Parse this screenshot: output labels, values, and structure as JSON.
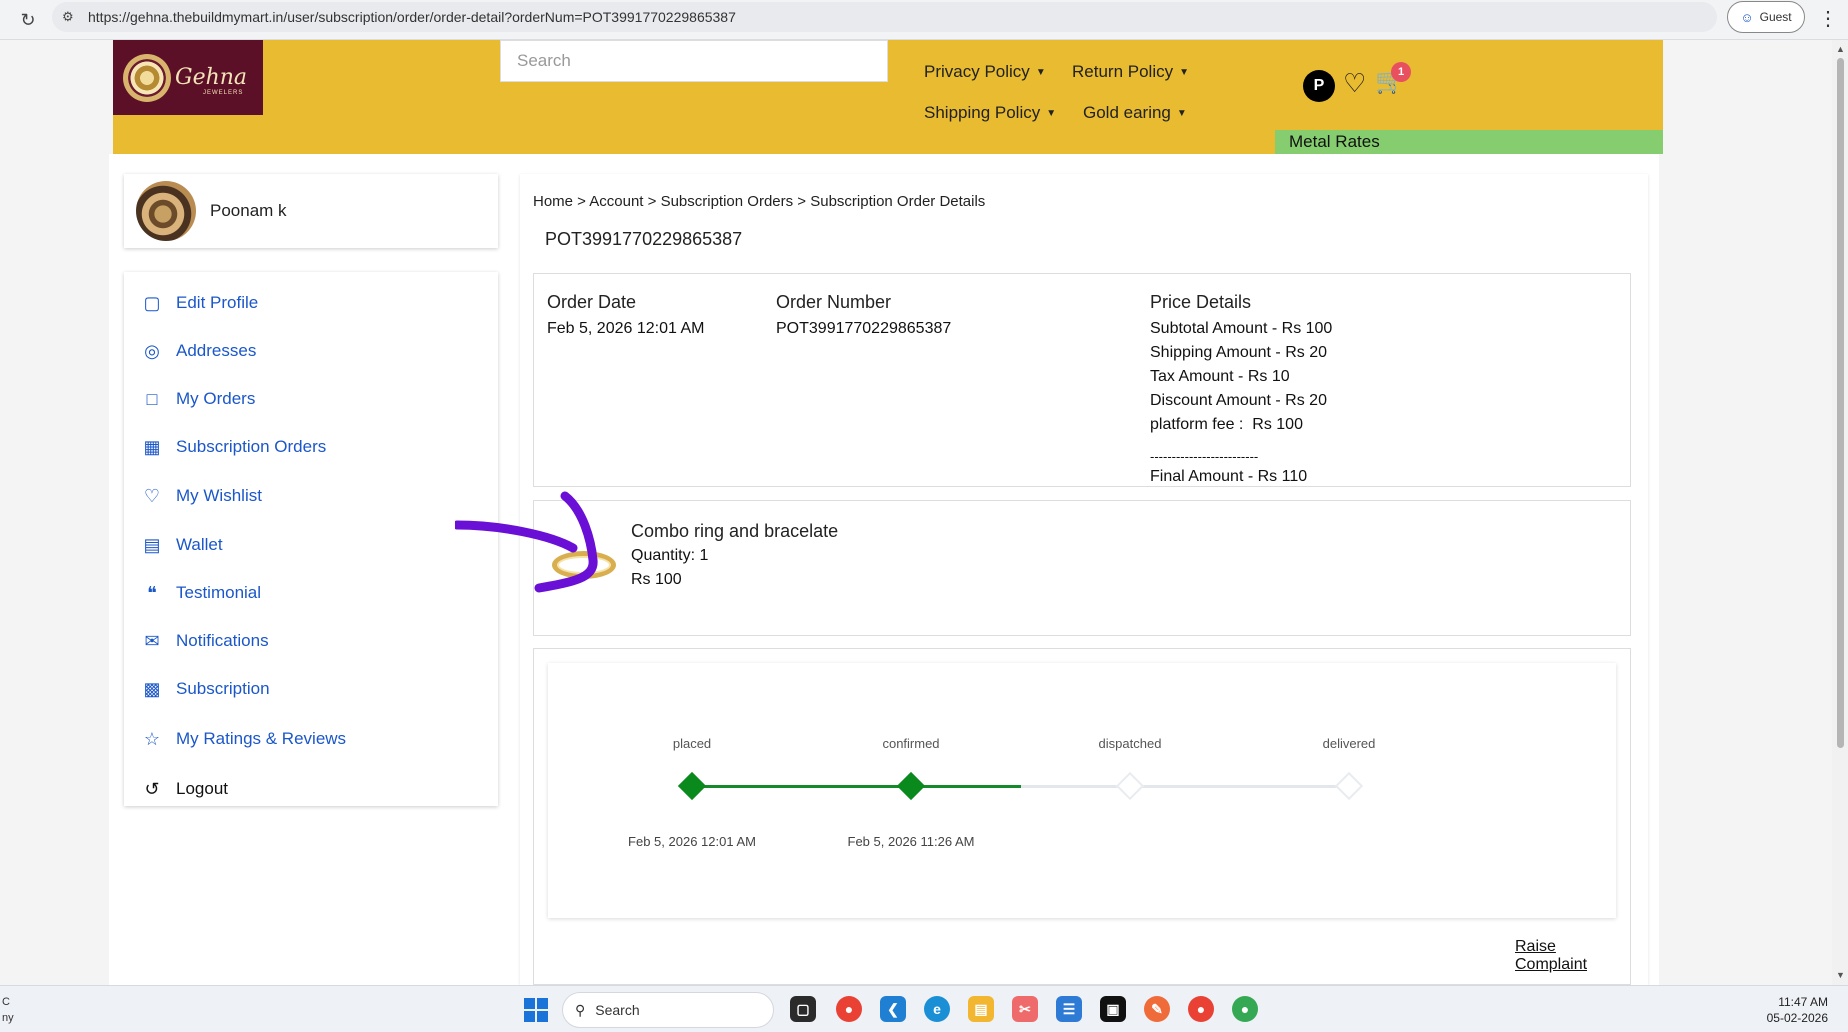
{
  "browser": {
    "url": "https://gehna.thebuildmymart.in/user/subscription/order/order-detail?orderNum=POT3991770229865387",
    "guest_label": "Guest"
  },
  "header": {
    "logo_text": "Gehna",
    "logo_sub": "JEWELERS",
    "search_placeholder": "Search",
    "nav": {
      "privacy": "Privacy Policy",
      "return": "Return Policy",
      "shipping": "Shipping Policy",
      "gold": "Gold earing"
    },
    "profile_initial": "P",
    "cart_count": "1",
    "metal_rates": "Metal Rates"
  },
  "sidebar": {
    "user_name": "Poonam k",
    "items": [
      {
        "label": "Edit Profile",
        "icon": "user-square-icon"
      },
      {
        "label": "Addresses",
        "icon": "location-pin-icon"
      },
      {
        "label": "My Orders",
        "icon": "orders-icon"
      },
      {
        "label": "Subscription Orders",
        "icon": "calendar-icon"
      },
      {
        "label": "My Wishlist",
        "icon": "heart-icon"
      },
      {
        "label": "Wallet",
        "icon": "wallet-icon"
      },
      {
        "label": "Testimonial",
        "icon": "quote-icon"
      },
      {
        "label": "Notifications",
        "icon": "mail-icon"
      },
      {
        "label": "Subscription",
        "icon": "subscription-icon"
      },
      {
        "label": "My Ratings & Reviews",
        "icon": "star-icon"
      },
      {
        "label": "Logout",
        "icon": "logout-icon"
      }
    ]
  },
  "breadcrumb": "Home > Account > Subscription Orders > Subscription Order Details",
  "order": {
    "heading": "POT3991770229865387",
    "order_date_label": "Order Date",
    "order_date": "Feb 5, 2026 12:01 AM",
    "order_number_label": "Order Number",
    "order_number": "POT3991770229865387",
    "price_label": "Price Details",
    "subtotal": "Subtotal Amount - Rs 100",
    "shipping": "Shipping Amount - Rs 20",
    "tax": "Tax Amount - Rs 10",
    "discount": "Discount Amount - Rs 20",
    "platform_fee": "platform fee :  Rs 100",
    "separator": "-------------------------",
    "final": "Final Amount - Rs 110"
  },
  "product": {
    "name": "Combo ring and bracelate",
    "quantity": "Quantity: 1",
    "price": "Rs 100"
  },
  "tracker": {
    "stages": [
      {
        "label": "placed",
        "date": "Feb 5, 2026 12:01 AM",
        "done": true
      },
      {
        "label": "confirmed",
        "date": "Feb 5, 2026 11:26 AM",
        "done": true
      },
      {
        "label": "dispatched",
        "date": "",
        "done": false
      },
      {
        "label": "delivered",
        "date": "",
        "done": false
      }
    ],
    "raise_complaint": "Raise Complaint"
  },
  "taskbar": {
    "weather_line1": "C",
    "weather_line2": "ny",
    "search_label": "Search",
    "time": "11:47 AM",
    "date": "05-02-2026"
  },
  "colors": {
    "header": "#e8bb31",
    "metal_rates": "#86cd6f",
    "link": "#1b57c9",
    "progress_done": "#0a8a1c",
    "annotation": "#6a0fd6"
  }
}
